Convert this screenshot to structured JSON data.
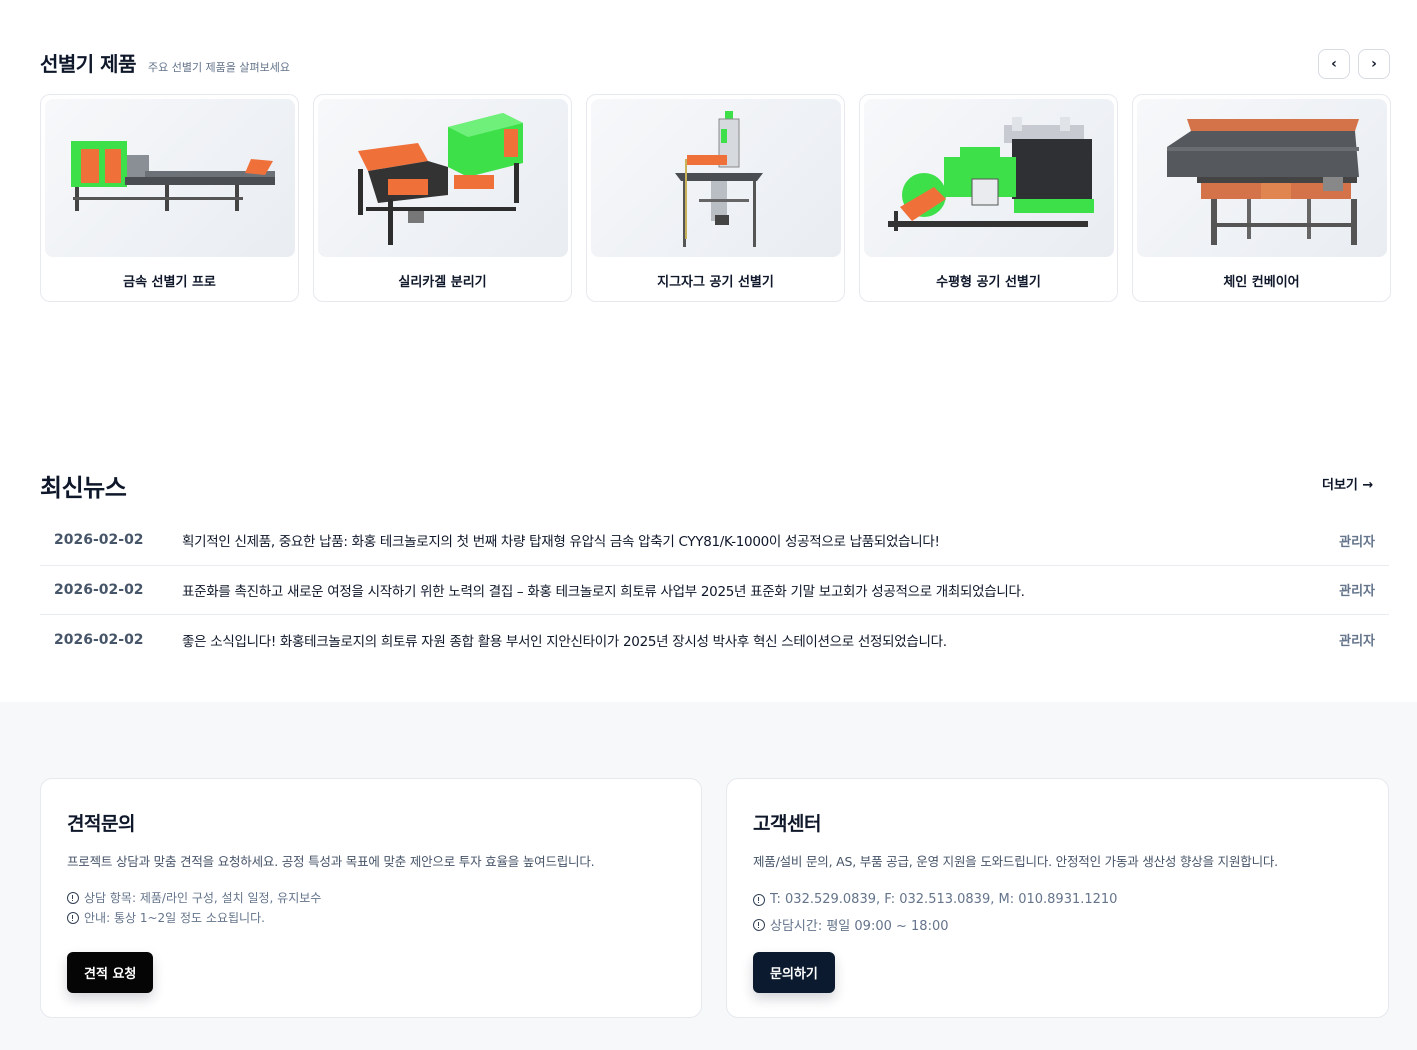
{
  "products": {
    "title": "선별기 제품",
    "subtitle": "주요 선별기 제품을 살펴보세요",
    "prev_label": "‹",
    "next_label": "›",
    "items": [
      {
        "name": "금속 선별기 프로"
      },
      {
        "name": "실리카겔 분리기"
      },
      {
        "name": "지그자그 공기 선별기"
      },
      {
        "name": "수평형 공기 선별기"
      },
      {
        "name": "체인 컨베이어"
      }
    ]
  },
  "news": {
    "title": "최신뉴스",
    "more_label": "더보기 →",
    "rows": [
      {
        "date": "2026-02-02",
        "text": "획기적인 신제품, 중요한 납품: 화홍 테크놀로지의 첫 번째 차량 탑재형 유압식 금속 압축기 CYY81/K-1000이 성공적으로 납품되었습니다!",
        "author": "관리자"
      },
      {
        "date": "2026-02-02",
        "text": "표준화를 촉진하고 새로운 여정을 시작하기 위한 노력의 결집 – 화홍 테크놀로지 희토류 사업부 2025년 표준화 기말 보고회가 성공적으로 개최되었습니다.",
        "author": "관리자"
      },
      {
        "date": "2026-02-02",
        "text": "좋은 소식입니다! 화홍테크놀로지의 희토류 자원 종합 활용 부서인 지안신타이가 2025년 장시성 박사후 혁신 스테이션으로 선정되었습니다.",
        "author": "관리자"
      }
    ]
  },
  "quote": {
    "title": "견적문의",
    "desc": "프로젝트 상담과 맞춤 견적을 요청하세요. 공정 특성과 목표에 맞춘 제안으로 투자 효율을 높여드립니다.",
    "info": [
      "상담 항목: 제품/라인 구성, 설치 일정, 유지보수",
      "안내: 통상 1~2일 정도 소요됩니다."
    ],
    "button": "견적 요청"
  },
  "support": {
    "title": "고객센터",
    "desc": "제품/설비 문의, AS, 부품 공급, 운영 지원을 도와드립니다. 안정적인 가동과 생산성 향상을 지원합니다.",
    "info": [
      "T: 032.529.0839, F: 032.513.0839, M: 010.8931.1210",
      "상담시간: 평일 09:00 ~ 18:00"
    ],
    "button": "문의하기"
  },
  "colors": {
    "accent_green": "#3ee04a",
    "accent_orange": "#f0703a",
    "machine_dark": "#3a3a3a",
    "navy": "#0b1a2e"
  }
}
